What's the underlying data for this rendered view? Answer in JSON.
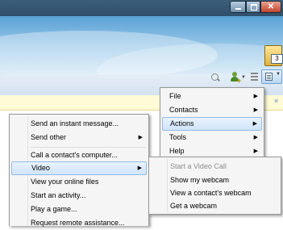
{
  "window": {
    "buttons": {
      "minimize_icon": "minimize-icon",
      "maximize_icon": "maximize-icon",
      "close_label": "✕"
    }
  },
  "header": {
    "notification_count": "3"
  },
  "toolbar": {
    "icons": [
      "search-icon",
      "add-contact-icon",
      "layout-icon",
      "show-menu-icon"
    ]
  },
  "infobar": {
    "close_label": "×"
  },
  "main_menu": {
    "items": [
      {
        "label": "File",
        "submenu": true
      },
      {
        "label": "Contacts",
        "submenu": true
      },
      {
        "label": "Actions",
        "submenu": true,
        "highlighted": true
      },
      {
        "label": "Tools",
        "submenu": true
      },
      {
        "label": "Help",
        "submenu": true
      }
    ]
  },
  "actions_menu": {
    "items": [
      {
        "label": "Send an instant message..."
      },
      {
        "label": "Send other",
        "submenu": true
      },
      {
        "label": "Call a contact's computer..."
      },
      {
        "label": "Video",
        "submenu": true,
        "highlighted": true
      },
      {
        "label": "View your online files"
      },
      {
        "label": "Start an activity..."
      },
      {
        "label": "Play a game..."
      },
      {
        "label": "Request remote assistance..."
      }
    ]
  },
  "video_menu": {
    "items": [
      {
        "label": "Start a Video Call",
        "disabled": true
      },
      {
        "label": "Show my webcam"
      },
      {
        "label": "View a contact's webcam"
      },
      {
        "label": "Get a webcam"
      }
    ]
  },
  "submenu_arrow": "▶",
  "colors": {
    "highlight_border": "#90bce9",
    "infobar": "#fffbd6",
    "sky": "#5aa1d6"
  }
}
